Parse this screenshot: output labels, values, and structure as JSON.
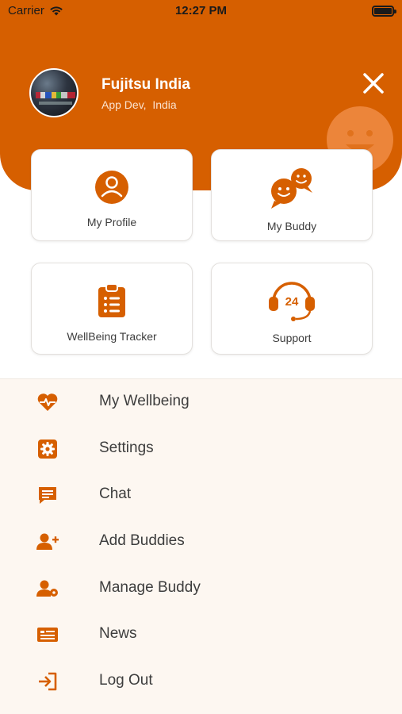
{
  "status_bar": {
    "carrier": "Carrier",
    "time": "12:27 PM"
  },
  "header": {
    "user_name": "Fujitsu India",
    "user_subtitle": "App Dev,  India",
    "close_icon": "close-icon",
    "decoration_icon": "smiley-icon"
  },
  "cards": [
    {
      "label": "My Profile",
      "icon": "profile-icon"
    },
    {
      "label": "My Buddy",
      "icon": "chat-bubbles-icon"
    },
    {
      "label": "WellBeing Tracker",
      "icon": "clipboard-icon"
    },
    {
      "label": "Support",
      "icon": "headset-24-icon",
      "badge": "24"
    }
  ],
  "menu": {
    "items": [
      {
        "label": "My Wellbeing",
        "icon": "heart-pulse-icon"
      },
      {
        "label": "Settings",
        "icon": "gear-icon"
      },
      {
        "label": "Chat",
        "icon": "chat-icon"
      },
      {
        "label": "Add Buddies",
        "icon": "add-user-icon"
      },
      {
        "label": "Manage Buddy",
        "icon": "manage-user-icon"
      },
      {
        "label": "News",
        "icon": "news-icon"
      },
      {
        "label": "Log Out",
        "icon": "logout-icon"
      }
    ]
  },
  "colors": {
    "brand": "#d65f00",
    "menu_background": "#fdf7f1",
    "text": "#3d3d3d"
  }
}
